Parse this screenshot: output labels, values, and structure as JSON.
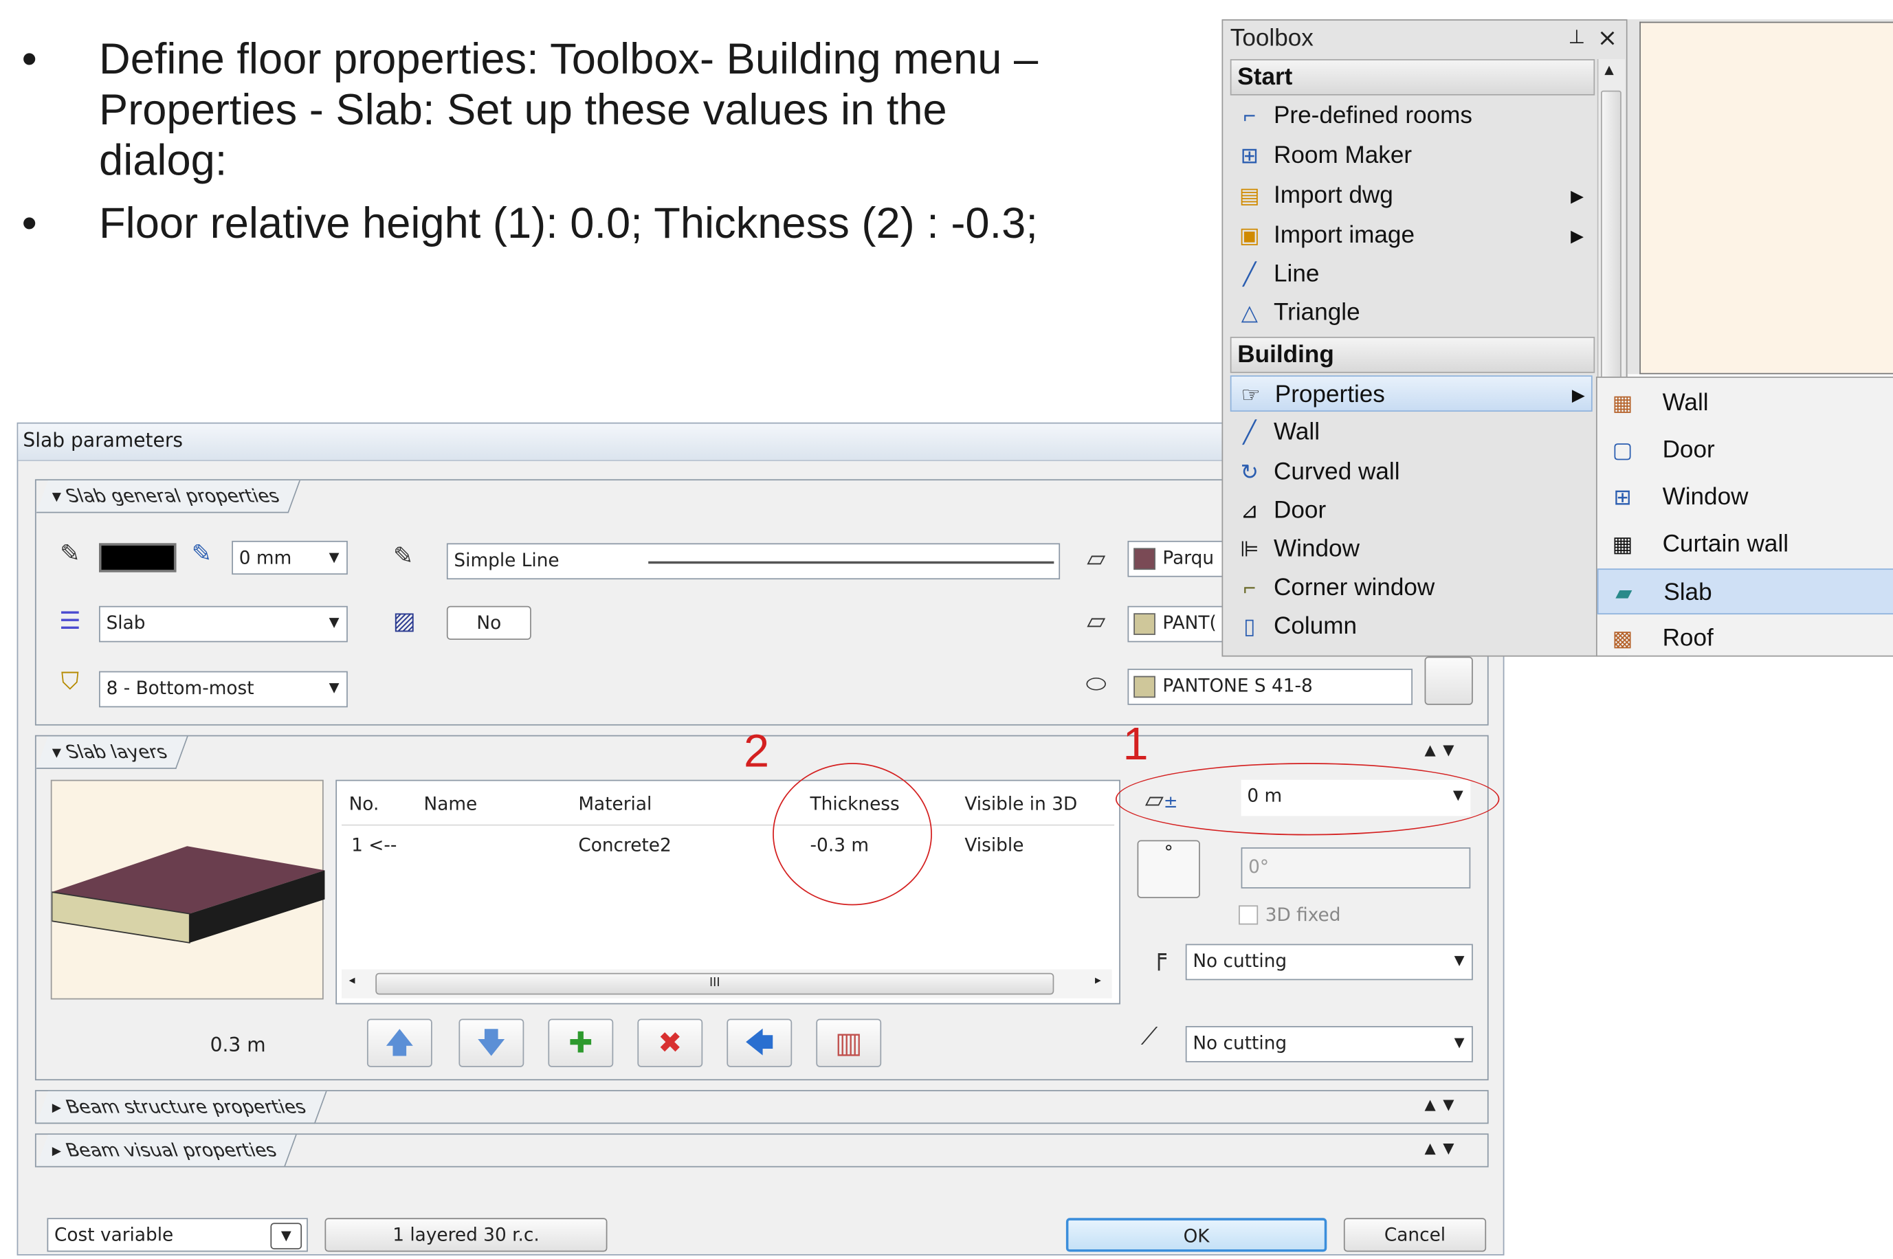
{
  "bullets": [
    "Define floor properties: Toolbox- Building menu – Properties - Slab:  Set up these values in the dialog:",
    "Floor relative height (1): 0.0; Thickness (2) : -0.3;"
  ],
  "bullet_glyph": "•",
  "dialog": {
    "title": "Slab parameters",
    "general": {
      "section_label": "Slab general properties",
      "pen_width": "0 mm",
      "line_type": "Simple Line",
      "layer": "Slab",
      "no_label": "No",
      "order": "8 - Bottom-most",
      "material_top": "Parqu",
      "material_side": "PANT(",
      "material_bottom": "PANTONE S 41-8"
    },
    "layers": {
      "section_label": "Slab layers",
      "preview_thickness": "0.3 m",
      "columns": [
        "No.",
        "Name",
        "Material",
        "Thickness",
        "Visible in 3D"
      ],
      "rows": [
        [
          "1 <--",
          "",
          "Concrete2",
          "-0.3 m",
          "Visible"
        ]
      ],
      "scroll_grip": "III",
      "height_value": "0 m",
      "angle_value": "0°",
      "degree_symbol": "°",
      "fixed_label": "3D fixed",
      "cutting_1": "No cutting",
      "cutting_2": "No cutting",
      "annotation_1": "1",
      "annotation_2": "2"
    },
    "beam_structure_label": "Beam structure properties",
    "beam_visual_label": "Beam visual properties",
    "cost_variable": "Cost variable",
    "layered_label": "1 layered 30 r.c.",
    "ok_label": "OK",
    "cancel_label": "Cancel"
  },
  "toolbox": {
    "title": "Toolbox",
    "pin_glyph": "ᵖ",
    "close_glyph": "×",
    "start_header": "Start",
    "start_items": [
      "Pre-defined rooms",
      "Room Maker",
      "Import dwg",
      "Import image",
      "Line",
      "Triangle"
    ],
    "building_header": "Building",
    "building_items": [
      "Properties",
      "Wall",
      "Curved wall",
      "Door",
      "Window",
      "Corner window",
      "Column"
    ],
    "submenu_items": [
      "Wall",
      "Door",
      "Window",
      "Curtain wall",
      "Slab",
      "Roof"
    ],
    "highlight_color": "#cfe0f5"
  }
}
